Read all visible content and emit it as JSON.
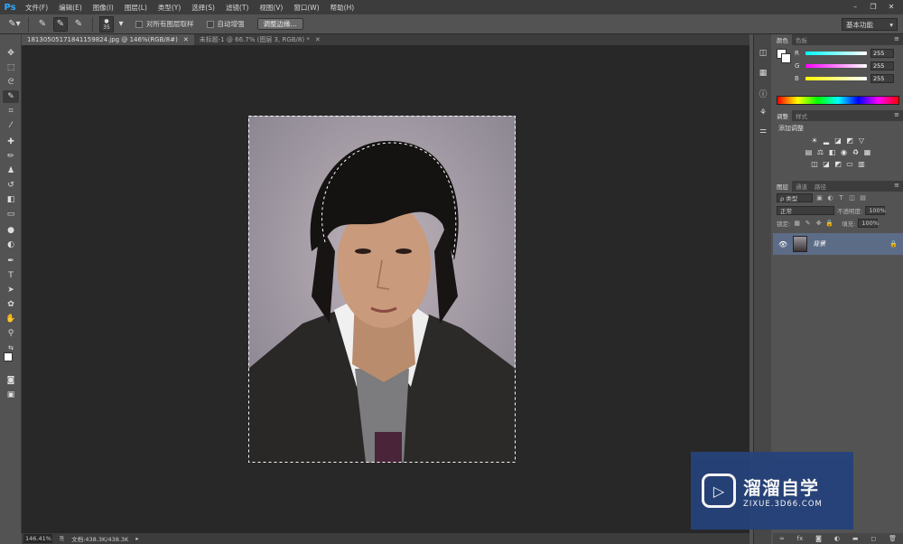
{
  "app": {
    "logo": "Ps"
  },
  "menu": [
    "文件(F)",
    "编辑(E)",
    "图像(I)",
    "图层(L)",
    "类型(Y)",
    "选择(S)",
    "滤镜(T)",
    "视图(V)",
    "窗口(W)",
    "帮助(H)"
  ],
  "window_controls": [
    "–",
    "❐",
    "✕"
  ],
  "options": {
    "brush_size": "35",
    "sample_all_layers": "对所有图层取样",
    "auto_enhance": "自动增强",
    "refine_edge": "调整边缘...",
    "workspace": "基本功能"
  },
  "tabs": [
    {
      "title": "18130505171841159824.jpg @ 146%(RGB/8#)",
      "active": true
    },
    {
      "title": "未标题-1 @ 66.7% (图层 3, RGB/8) *",
      "active": false
    }
  ],
  "status": {
    "zoom": "146.41%",
    "doc": "文档:438.3K/438.3K"
  },
  "color_panel": {
    "tabs": [
      "颜色",
      "色板"
    ],
    "channels": [
      {
        "label": "R",
        "value": "255",
        "color": "#ff4040"
      },
      {
        "label": "G",
        "value": "255",
        "color": "#40ff40"
      },
      {
        "label": "B",
        "value": "255",
        "color": "#4080ff"
      }
    ]
  },
  "adjust_panel": {
    "tabs": [
      "调整",
      "样式"
    ],
    "title": "添加调整"
  },
  "layers_panel": {
    "tabs": [
      "图层",
      "通道",
      "路径"
    ],
    "kind": "ρ 类型",
    "blend_mode": "正常",
    "opacity_label": "不透明度:",
    "opacity_value": "100%",
    "lock_label": "锁定:",
    "fill_label": "填充:",
    "fill_value": "100%",
    "layer_name": "背景"
  },
  "watermark": {
    "title": "溜溜自学",
    "subtitle": "ZIXUE.3D66.COM"
  }
}
